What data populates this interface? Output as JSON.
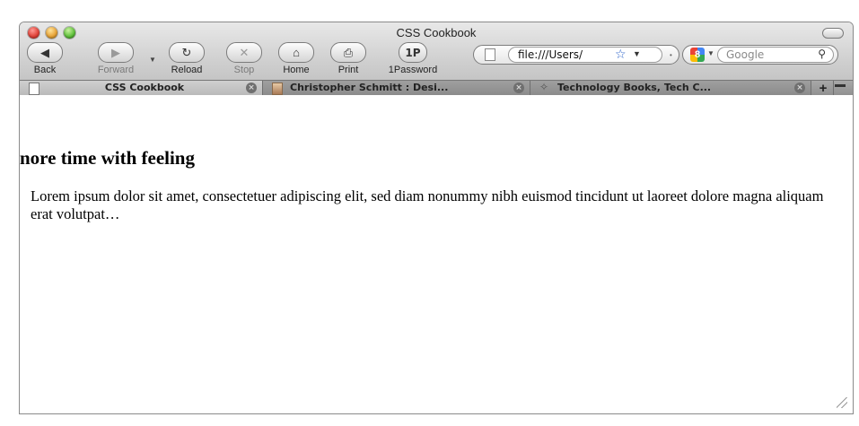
{
  "window": {
    "title": "CSS Cookbook"
  },
  "toolbar": {
    "back_label": "Back",
    "forward_label": "Forward",
    "reload_label": "Reload",
    "stop_label": "Stop",
    "home_label": "Home",
    "print_label": "Print",
    "onepassword_label": "1Password",
    "onepassword_icon_text": "1P"
  },
  "address": {
    "url": "file:///Users/"
  },
  "search": {
    "placeholder": "Google"
  },
  "tabs": [
    {
      "label": "CSS Cookbook",
      "active": true
    },
    {
      "label": "Christopher Schmitt : Desi...",
      "active": false
    },
    {
      "label": "Technology Books, Tech C...",
      "active": false
    }
  ],
  "page": {
    "heading": "nore time with feeling",
    "paragraph": "Lorem ipsum dolor sit amet, consectetuer adipiscing elit, sed diam nonummy nibh euismod tincidunt ut laoreet dolore magna aliquam erat volutpat…"
  },
  "colors": {
    "chrome_top": "#e8e8e8",
    "chrome_bottom": "#bdbdbd",
    "star": "#2a62c9"
  }
}
